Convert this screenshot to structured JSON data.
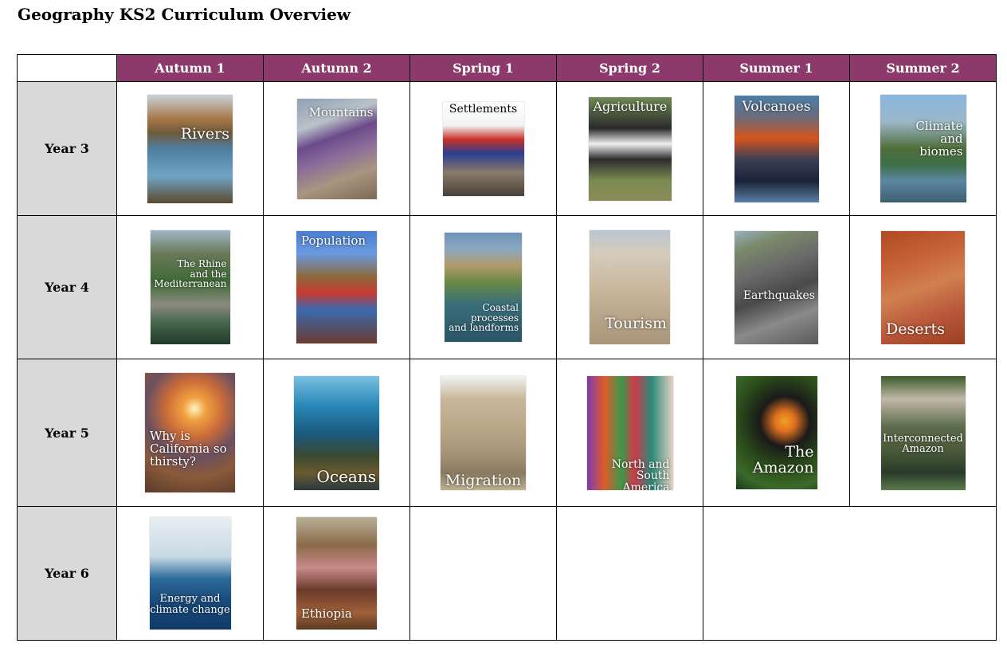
{
  "title": "Geography KS2 Curriculum Overview",
  "header": {
    "terms": [
      "Autumn 1",
      "Autumn 2",
      "Spring 1",
      "Spring 2",
      "Summer 1",
      "Summer 2"
    ]
  },
  "colors": {
    "header_bg": "#8b3a6b",
    "year_bg": "#d9d9d9"
  },
  "years": [
    {
      "label": "Year 3",
      "topics": [
        {
          "text": "Rivers",
          "image": "river-through-town"
        },
        {
          "text": "Mountains",
          "image": "student-reading-on-mountain"
        },
        {
          "text": "Settlements",
          "image": "london-street-underground-sign"
        },
        {
          "text": "Agriculture",
          "image": "cows-in-field"
        },
        {
          "text": "Volcanoes",
          "image": "erupting-volcano-night"
        },
        {
          "text": "Climate\nand\nbiomes",
          "image": "punting-river-college"
        }
      ]
    },
    {
      "label": "Year 4",
      "topics": [
        {
          "text": "The Rhine\nand the\nMediterranean",
          "image": "rhine-castle-village"
        },
        {
          "text": "Population",
          "image": "big-ben-flags"
        },
        {
          "text": "Coastal\nprocesses\nand landforms",
          "image": "coastal-arch-cove"
        },
        {
          "text": "Tourism",
          "image": "sandcastle-beach"
        },
        {
          "text": "Earthquakes",
          "image": "cracked-road"
        },
        {
          "text": "Deserts",
          "image": "meerkat-red-sand"
        }
      ]
    },
    {
      "label": "Year 5",
      "topics": [
        {
          "text": "Why is\nCalifornia so\nthirsty?",
          "image": "sunset-dry-land"
        },
        {
          "text": "Oceans",
          "image": "underwater-coral"
        },
        {
          "text": "Migration",
          "image": "refugee-tents"
        },
        {
          "text": "North and\nSouth America",
          "image": "colorful-buildings"
        },
        {
          "text": "The\nAmazon",
          "image": "toucan"
        },
        {
          "text": "Interconnected\nAmazon",
          "image": "amazon-family"
        }
      ]
    },
    {
      "label": "Year 6",
      "topics": [
        {
          "text": "Energy and\nclimate change",
          "image": "offshore-wind-turbines"
        },
        {
          "text": "Ethiopia",
          "image": "classroom-students"
        }
      ]
    }
  ]
}
